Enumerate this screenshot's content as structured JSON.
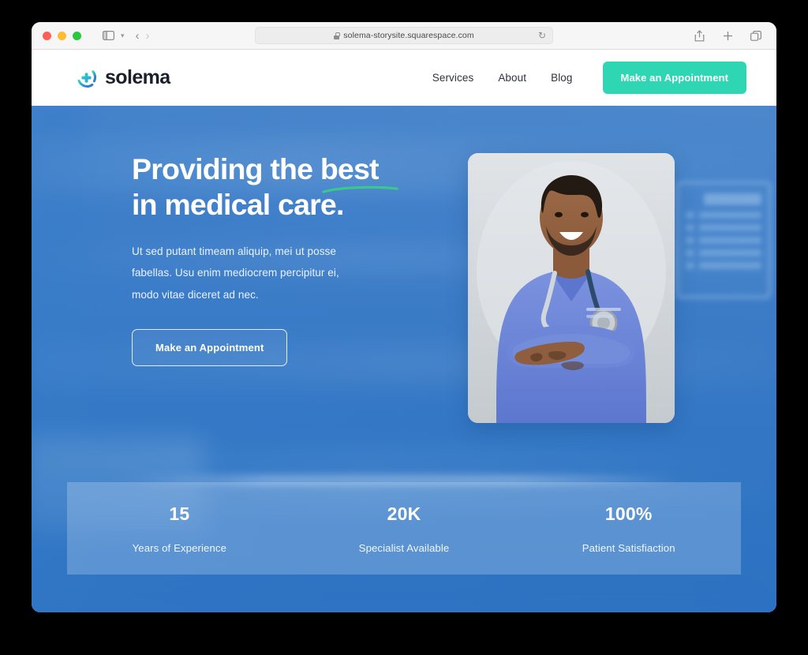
{
  "browser": {
    "url": "solema-storysite.squarespace.com",
    "lock_icon": "lock-icon",
    "reload_icon": "reload-icon",
    "sidebar_icon": "sidebar-toggle-icon",
    "back_icon": "back-arrow-icon",
    "forward_icon": "forward-arrow-icon",
    "share_icon": "share-icon",
    "new_tab_icon": "plus-icon",
    "tabs_icon": "tab-overview-icon",
    "traffic_lights": [
      "close",
      "minimize",
      "zoom"
    ]
  },
  "site": {
    "logo_text": "solema",
    "logo_icon": "medical-cross-circle-icon",
    "nav_links": [
      {
        "label": "Services"
      },
      {
        "label": "About"
      },
      {
        "label": "Blog"
      }
    ],
    "nav_cta": "Make an Appointment"
  },
  "hero": {
    "title_line1_pre": "Providing the ",
    "title_highlight": "best",
    "title_line2": "in medical care.",
    "paragraph": "Ut sed putant timeam aliquip, mei ut posse fabellas. Usu enim mediocrem percipitur ei, modo vitae diceret ad nec.",
    "cta": "Make an Appointment",
    "image_alt": "smiling-doctor-in-blue-scrubs-with-stethoscope",
    "stats": [
      {
        "value": "15",
        "label": "Years of Experience"
      },
      {
        "value": "20K",
        "label": "Specialist Available"
      },
      {
        "value": "100%",
        "label": "Patient Satisfiaction"
      }
    ]
  },
  "colors": {
    "accent_teal": "#2fd6b3",
    "underline_green": "#3bc98a",
    "hero_blue": "#3f7fc8",
    "logo_dark": "#1b1f2b"
  }
}
